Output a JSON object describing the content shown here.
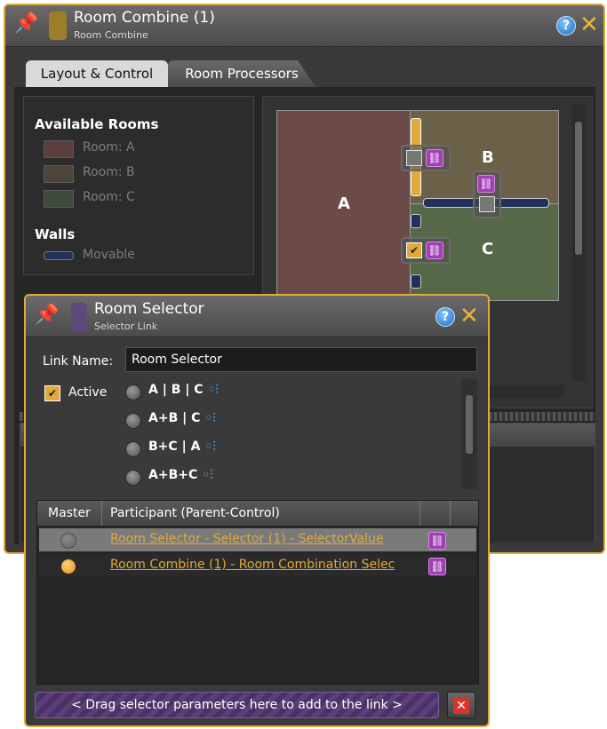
{
  "outer_window": {
    "title": "Room Combine (1)",
    "subtitle": "Room Combine",
    "swatch_color": "#9b7d2a",
    "tabs": [
      {
        "label": "Layout & Control",
        "active": true
      },
      {
        "label": "Room Processors",
        "active": false
      }
    ],
    "available_rooms_heading": "Available Rooms",
    "rooms": [
      {
        "label": "Room: A",
        "color": "#5a3e3a"
      },
      {
        "label": "Room: B",
        "color": "#4d4538"
      },
      {
        "label": "Room: C",
        "color": "#3f4a3a"
      }
    ],
    "walls_heading": "Walls",
    "walls": [
      {
        "label": "Movable"
      }
    ],
    "layout": {
      "room_a": {
        "letter": "A",
        "color": "#6b4a48"
      },
      "room_b": {
        "letter": "B",
        "color": "#6b6148"
      },
      "room_c": {
        "letter": "C",
        "color": "#556848"
      }
    },
    "accent": "#e0a93a"
  },
  "popup": {
    "title": "Room Selector",
    "subtitle": "Selector Link",
    "swatch_color": "#5d4a7a",
    "link_name_label": "Link Name:",
    "link_name_value": "Room Selector",
    "active_label": "Active",
    "active_checked": true,
    "combinations": [
      {
        "parts": [
          "A",
          "|",
          "B",
          "|",
          "C"
        ]
      },
      {
        "parts": [
          "A+B",
          "|",
          "C"
        ]
      },
      {
        "parts": [
          "B+C",
          "|",
          "A"
        ]
      },
      {
        "parts": [
          "A+B+C"
        ]
      }
    ],
    "grid": {
      "col_master": "Master",
      "col_participant": "Participant (Parent-Control)",
      "rows": [
        {
          "master": false,
          "participant": "Room Selector - Selector (1) - SelectorValue"
        },
        {
          "master": true,
          "participant": "Room Combine (1) - Room Combination Selec"
        }
      ]
    },
    "drop_hint": "< Drag selector parameters here to add to the link >"
  }
}
